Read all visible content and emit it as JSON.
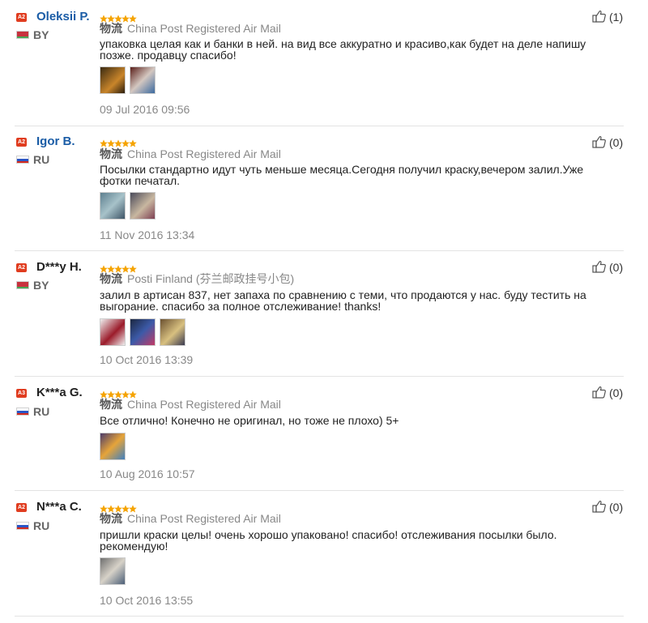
{
  "reviews": [
    {
      "level": "A2",
      "name": "Oleksii P.",
      "name_style": "blue",
      "country": "BY",
      "logistics_label": "物流",
      "logistics": "China Post Registered Air Mail",
      "text": "упаковка целая как и банки в ней. на вид все аккуратно и красиво,как будет на деле напишу позже. продавцу спасибо!",
      "photos": [
        "photo-1",
        "photo-2"
      ],
      "date": "09 Jul 2016 09:56",
      "likes": "(1)",
      "rating": 5
    },
    {
      "level": "A2",
      "name": "Igor B.",
      "name_style": "blue",
      "country": "RU",
      "logistics_label": "物流",
      "logistics": "China Post Registered Air Mail",
      "text": "Посылки стандартно идут чуть меньше месяца.Сегодня получил краску,вечером залил.Уже фотки печатал.",
      "photos": [
        "photo-1",
        "photo-2"
      ],
      "date": "11 Nov 2016 13:34",
      "likes": "(0)",
      "rating": 5
    },
    {
      "level": "A2",
      "name": "D***y H.",
      "name_style": "dark",
      "country": "BY",
      "logistics_label": "物流",
      "logistics": "Posti Finland (芬兰邮政挂号小包)",
      "text": "залил в артисан 837, нет запаха по сравнению с теми, что продаются у нас. буду тестить на выгорание. спасибо за полное отслеживание! thanks!",
      "photos": [
        "photo-1",
        "photo-2",
        "photo-3"
      ],
      "date": "10 Oct 2016 13:39",
      "likes": "(0)",
      "rating": 5
    },
    {
      "level": "A3",
      "name": "K***a G.",
      "name_style": "dark",
      "country": "RU",
      "logistics_label": "物流",
      "logistics": "China Post Registered Air Mail",
      "text": "Все отлично! Конечно не оригинал, но тоже не плохо) 5+",
      "photos": [
        "photo-1"
      ],
      "date": "10 Aug 2016 10:57",
      "likes": "(0)",
      "rating": 5
    },
    {
      "level": "A2",
      "name": "N***a C.",
      "name_style": "dark",
      "country": "RU",
      "logistics_label": "物流",
      "logistics": "China Post Registered Air Mail",
      "text": "пришли краски целы! очень хорошо упаковано! спасибо! отслеживания посылки было. рекомендую!",
      "photos": [
        "photo-1"
      ],
      "date": "10 Oct 2016 13:55",
      "likes": "(0)",
      "rating": 5
    }
  ],
  "colors": {
    "name_blue": "#1a5ca6",
    "star": "#f5a300",
    "level_badge": "#e03c1f",
    "meta_gray": "#888888"
  },
  "icons": {
    "level": "level-badge-icon",
    "flag_by": "belarus-flag-icon",
    "flag_ru": "russia-flag-icon",
    "star": "star-icon",
    "like": "thumbs-up-icon"
  }
}
